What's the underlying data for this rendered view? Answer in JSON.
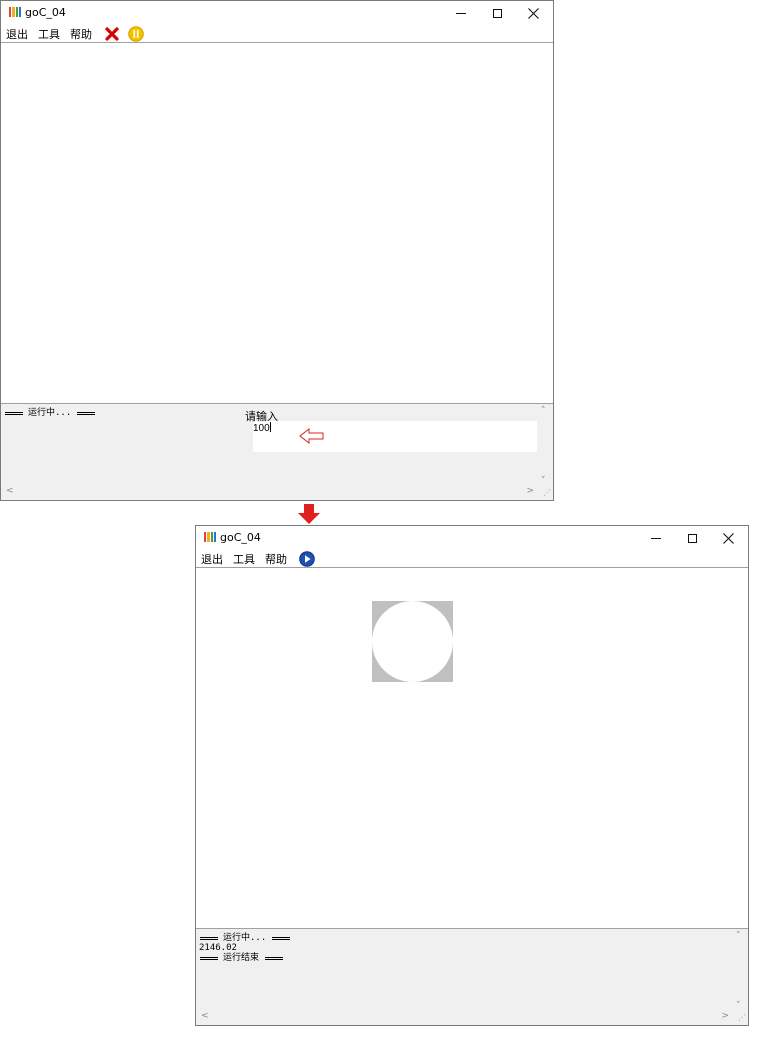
{
  "top_window": {
    "title": "goC_04",
    "menu": {
      "exit": "退出",
      "tools": "工具",
      "help": "帮助"
    },
    "toolbar_icons": [
      "stop-icon",
      "pause-icon"
    ],
    "console": {
      "status": "运行中...",
      "prompt_label": "请输入",
      "input_value": "100"
    }
  },
  "bottom_window": {
    "title": "goC_04",
    "menu": {
      "exit": "退出",
      "tools": "工具",
      "help": "帮助"
    },
    "toolbar_icons": [
      "run-icon"
    ],
    "console": {
      "status_running": "运行中...",
      "output_value": "2146.02",
      "status_done": "运行结束"
    }
  },
  "colors": {
    "accent_red": "#e02020",
    "stop_red": "#d40000",
    "pause_yellow": "#f2c200",
    "run_blue": "#1e50b4",
    "shape_gray": "#c0c0c0"
  }
}
